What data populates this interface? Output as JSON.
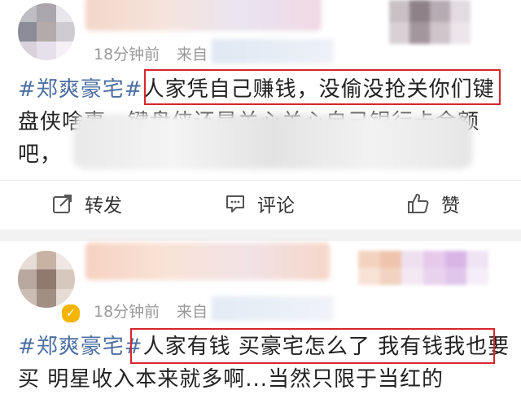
{
  "post1": {
    "time": "18分钟前",
    "source_label": "来自",
    "hashtag": "#郑爽豪宅#",
    "highlight": "人家凭自己赚钱，没偷没抢关你们键",
    "line2": "盘侠啥事，键盘侠还是关心关心自己银行卡余额",
    "line3_start": "吧，",
    "actions": {
      "repost": "转发",
      "comment": "评论",
      "like": "赞"
    }
  },
  "post2": {
    "time": "18分钟前",
    "source_label": "来自",
    "hashtag": "#郑爽豪宅#",
    "highlight": "人家有钱 买豪宅怎么了 我有钱我也要",
    "line2": "买 明星收入本来就多啊...当然只限于当红的"
  }
}
